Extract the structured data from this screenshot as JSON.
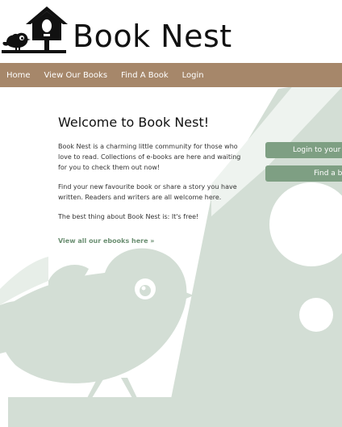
{
  "site": {
    "title": "Book Nest"
  },
  "nav": {
    "items": [
      {
        "label": "Home"
      },
      {
        "label": "View Our Books"
      },
      {
        "label": "Find A Book"
      },
      {
        "label": "Login"
      }
    ]
  },
  "main": {
    "heading": "Welcome to Book Nest!",
    "paragraphs": [
      "Book Nest is a charming little community for those who love to read. Collections of e-books are here and waiting for you to check them out now!",
      "Find your new favourite book or share a story you have written. Readers and writers are all welcome here.",
      "The best thing about Book Nest is: It's free!"
    ],
    "view_all_link": "View all our ebooks here »"
  },
  "sidebar": {
    "login_button": "Login to your B",
    "find_button": "Find a bo"
  },
  "colors": {
    "nav_bg": "#a6876a",
    "accent": "#7e9f83",
    "art": "#d3ded5",
    "link": "#6b8f72"
  },
  "icons": {
    "logo": "birdhouse-with-bird-icon"
  }
}
